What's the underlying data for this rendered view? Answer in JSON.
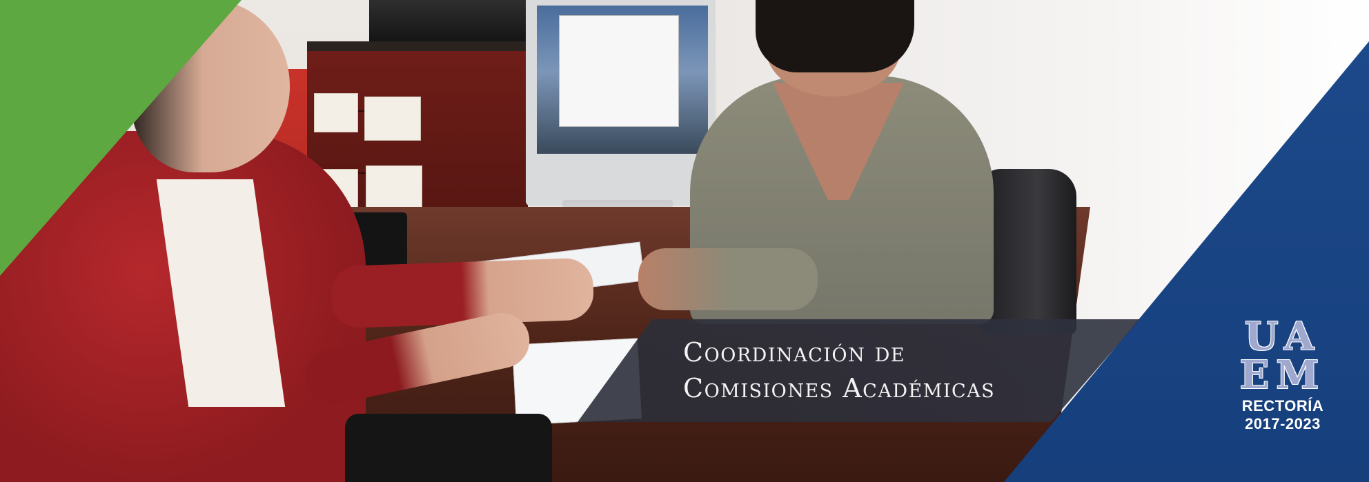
{
  "banner": {
    "title_line_1": "Coordinación de",
    "title_line_2": "Comisiones Académicas",
    "logo": {
      "mark_line_1": "UA",
      "mark_line_2": "EM",
      "caption": "RECTORÍA",
      "years": "2017-2023"
    }
  },
  "colors": {
    "green_accent": "#5ea841",
    "blue_band": "#1d4a8c",
    "title_band": "#2c2f3a",
    "logo_mark": "#9fa9cf"
  }
}
